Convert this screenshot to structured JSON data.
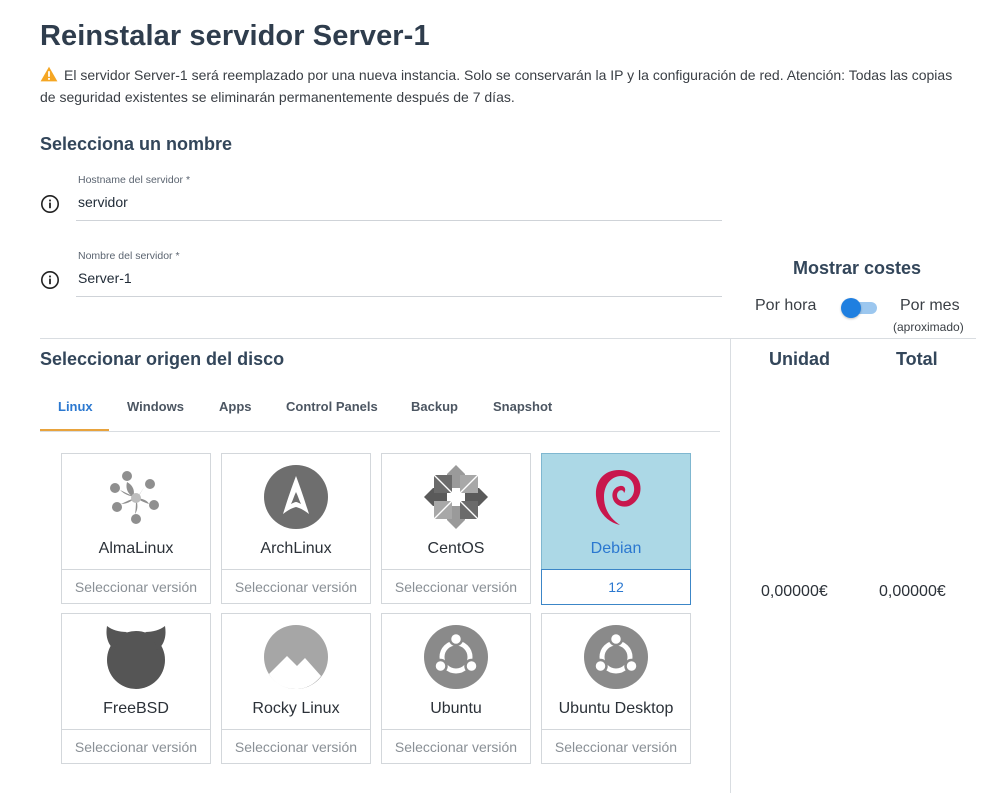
{
  "page": {
    "title": "Reinstalar servidor Server-1",
    "warning": "El servidor Server-1 será reemplazado por una nueva instancia. Solo se conservarán la IP y la configuración de red. Atención: Todas las copias de seguridad existentes se eliminarán permanentemente después de 7 días."
  },
  "name_section": {
    "title": "Selecciona un nombre",
    "hostname": {
      "label": "Hostname del servidor *",
      "value": "servidor"
    },
    "server_name": {
      "label": "Nombre del servidor *",
      "value": "Server-1"
    }
  },
  "costs": {
    "title": "Mostrar costes",
    "per_hour": "Por hora",
    "per_month": "Por mes",
    "approx": "(aproximado)",
    "toggle_state": "per_hour",
    "col_unit": "Unidad",
    "col_total": "Total",
    "unit_value": "0,00000€",
    "total_value": "0,00000€"
  },
  "disk_section": {
    "title": "Seleccionar origen del disco",
    "tabs": [
      "Linux",
      "Windows",
      "Apps",
      "Control Panels",
      "Backup",
      "Snapshot"
    ],
    "active_tab": "Linux"
  },
  "os_cards": [
    {
      "name": "AlmaLinux",
      "version": "Seleccionar versión",
      "icon": "almalinux-icon"
    },
    {
      "name": "ArchLinux",
      "version": "Seleccionar versión",
      "icon": "archlinux-icon"
    },
    {
      "name": "CentOS",
      "version": "Seleccionar versión",
      "icon": "centos-icon"
    },
    {
      "name": "Debian",
      "version": "12",
      "icon": "debian-icon",
      "selected": true
    },
    {
      "name": "FreeBSD",
      "version": "Seleccionar versión",
      "icon": "freebsd-icon"
    },
    {
      "name": "Rocky Linux",
      "version": "Seleccionar versión",
      "icon": "rocky-linux-icon"
    },
    {
      "name": "Ubuntu",
      "version": "Seleccionar versión",
      "icon": "ubuntu-icon"
    },
    {
      "name": "Ubuntu Desktop",
      "version": "Seleccionar versión",
      "icon": "ubuntu-desktop-icon"
    }
  ],
  "colors": {
    "accent": "#2b78d0",
    "tab_indicator": "#e8a33d",
    "selected_card_bg": "#acd8e6",
    "warning": "#f5a623",
    "debian_red": "#c8174d"
  }
}
